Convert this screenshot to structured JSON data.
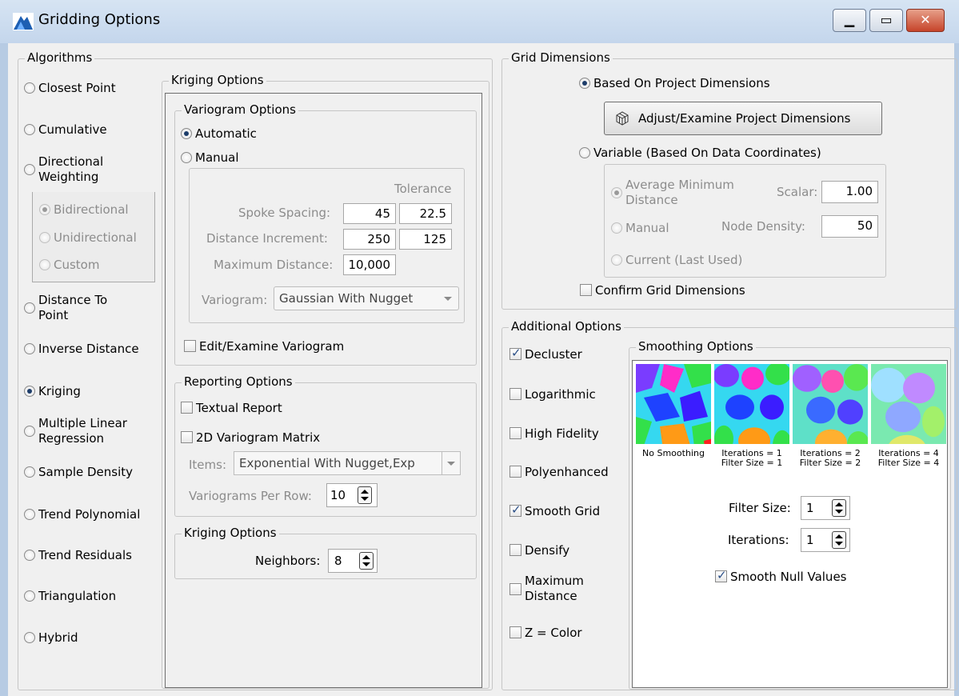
{
  "window": {
    "title": "Gridding Options"
  },
  "algorithms": {
    "title": "Algorithms",
    "items": {
      "closest_point": "Closest Point",
      "cumulative": "Cumulative",
      "directional_weighting_1": "Directional",
      "directional_weighting_2": "Weighting",
      "bidirectional": "Bidirectional",
      "unidirectional": "Unidirectional",
      "custom": "Custom",
      "distance_to_point_1": "Distance To",
      "distance_to_point_2": "Point",
      "inverse_distance": "Inverse Distance",
      "kriging": "Kriging",
      "mlr_1": "Multiple Linear",
      "mlr_2": "Regression",
      "sample_density": "Sample Density",
      "trend_polynomial": "Trend Polynomial",
      "trend_residuals": "Trend Residuals",
      "triangulation": "Triangulation",
      "hybrid": "Hybrid"
    },
    "selected": "Kriging"
  },
  "kriging": {
    "title": "Kriging Options",
    "variogram": {
      "title": "Variogram Options",
      "automatic": "Automatic",
      "manual": "Manual",
      "tolerance_header": "Tolerance",
      "spoke_spacing_label": "Spoke Spacing:",
      "spoke_spacing": "45",
      "spoke_spacing_tol": "22.5",
      "distance_increment_label": "Distance Increment:",
      "distance_increment": "250",
      "distance_increment_tol": "125",
      "maximum_distance_label": "Maximum Distance:",
      "maximum_distance": "10,000",
      "variogram_label": "Variogram:",
      "variogram_value": "Gaussian With Nugget",
      "edit_examine": "Edit/Examine Variogram"
    },
    "reporting": {
      "title": "Reporting Options",
      "textual_report": "Textual Report",
      "matrix": "2D Variogram Matrix",
      "items_label": "Items:",
      "items_value": "Exponential With Nugget,Exp",
      "per_row_label": "Variograms Per Row:",
      "per_row_value": "10"
    },
    "kriging_sub": {
      "title": "Kriging Options",
      "neighbors_label": "Neighbors:",
      "neighbors_value": "8"
    }
  },
  "grid_dimensions": {
    "title": "Grid Dimensions",
    "based_on_project": "Based On Project Dimensions",
    "adjust_button": "Adjust/Examine Project Dimensions",
    "variable": "Variable (Based On Data Coordinates)",
    "avg_min_distance_1": "Average Minimum",
    "avg_min_distance_2": "Distance",
    "scalar_label": "Scalar:",
    "scalar_value": "1.00",
    "manual": "Manual",
    "node_density_label": "Node Density:",
    "node_density_value": "50",
    "current": "Current (Last Used)",
    "confirm": "Confirm Grid Dimensions"
  },
  "additional": {
    "title": "Additional Options",
    "decluster": "Decluster",
    "logarithmic": "Logarithmic",
    "high_fidelity": "High Fidelity",
    "polyenhanced": "Polyenhanced",
    "smooth_grid": "Smooth Grid",
    "densify": "Densify",
    "maximum_distance_1": "Maximum",
    "maximum_distance_2": "Distance",
    "z_color": "Z = Color",
    "checked": {
      "decluster": true,
      "smooth_grid": true
    }
  },
  "smoothing": {
    "title": "Smoothing Options",
    "captions": [
      [
        "No Smoothing",
        ""
      ],
      [
        "Iterations = 1",
        "Filter Size = 1"
      ],
      [
        "Iterations = 2",
        "Filter Size = 2"
      ],
      [
        "Iterations = 4",
        "Filter Size = 4"
      ]
    ],
    "filter_size_label": "Filter Size:",
    "filter_size_value": "1",
    "iterations_label": "Iterations:",
    "iterations_value": "1",
    "smooth_null": "Smooth Null Values"
  },
  "colors": {
    "title_bar": "#c9daee",
    "group_border": "#c6c6c6",
    "check_mark": "#2b4f87",
    "close_button": "#c6442a"
  },
  "icons": {
    "app": "mountain-app-icon",
    "grid_button": "grid-cube-icon"
  }
}
